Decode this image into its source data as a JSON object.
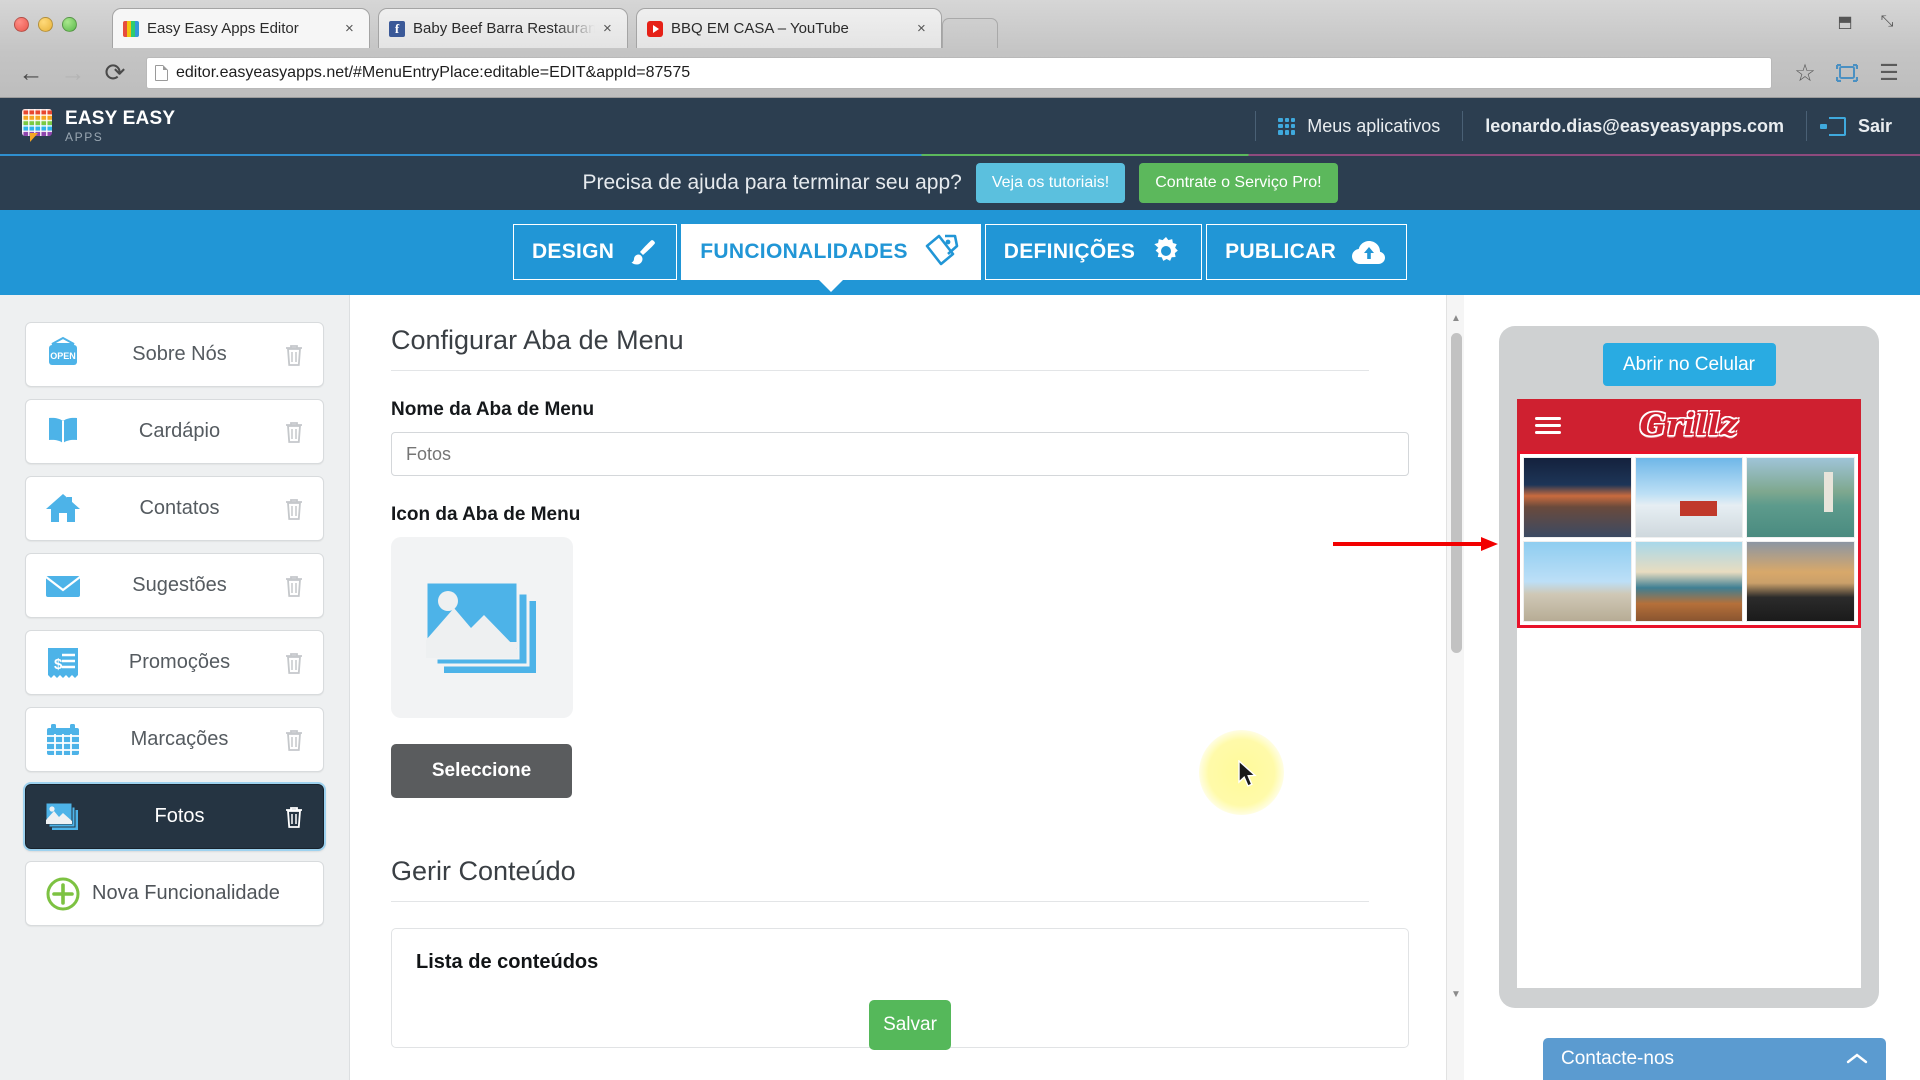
{
  "browser": {
    "tabs": [
      {
        "title": "Easy Easy Apps Editor",
        "favicon": "easyeasy-icon",
        "close": "×",
        "active": true
      },
      {
        "title": "Baby Beef Barra Restaurant",
        "favicon": "facebook-icon",
        "close": "×",
        "active": false
      },
      {
        "title": "BBQ EM CASA – YouTube",
        "favicon": "youtube-icon",
        "close": "×",
        "active": false
      }
    ],
    "facebook_glyph": "f",
    "back": "←",
    "forward": "→",
    "reload": "⟳",
    "url": "editor.easyeasyapps.net/#MenuEntryPlace:editable=EDIT&appId=87575",
    "bookmark_star": "☆",
    "cast_icon": "cast-icon",
    "menu_icon": "☰",
    "window_minimize": "⬒",
    "window_maximize": "⤡"
  },
  "header": {
    "logo_line1": "EASY EASY",
    "logo_line2": "APPS",
    "apps_label": "Meus aplicativos",
    "user_email": "leonardo.dias@easyeasyapps.com",
    "logout_label": "Sair"
  },
  "promo": {
    "text": "Precisa de ajuda para terminar seu app?",
    "tutorials_label": "Veja os tutoriais!",
    "pro_label": "Contrate o Serviço Pro!",
    "tutorials_color": "#5bc0de",
    "pro_color": "#5cb85c"
  },
  "nav_tabs": [
    {
      "label": "DESIGN",
      "icon": "brush-icon",
      "active": false
    },
    {
      "label": "FUNCIONALIDADES",
      "icon": "tags-icon",
      "active": true
    },
    {
      "label": "DEFINIÇÕES",
      "icon": "gear-icon",
      "active": false
    },
    {
      "label": "PUBLICAR",
      "icon": "cloud-upload-icon",
      "active": false
    }
  ],
  "sidebar": {
    "items": [
      {
        "label": "Sobre Nós",
        "icon": "open-sign-icon",
        "selected": false
      },
      {
        "label": "Cardápio",
        "icon": "book-icon",
        "selected": false
      },
      {
        "label": "Contatos",
        "icon": "house-icon",
        "selected": false
      },
      {
        "label": "Sugestões",
        "icon": "envelope-icon",
        "selected": false
      },
      {
        "label": "Promoções",
        "icon": "receipt-dollar-icon",
        "selected": false
      },
      {
        "label": "Marcações",
        "icon": "calendar-icon",
        "selected": false
      },
      {
        "label": "Fotos",
        "icon": "photos-icon",
        "selected": true
      }
    ],
    "new_feature_label": "Nova Funcionalidade",
    "trash_icon": "trash-icon",
    "plus_icon": "plus-circle-icon"
  },
  "main": {
    "section_title": "Configurar Aba de Menu",
    "name_label": "Nome da Aba de Menu",
    "name_value": "Fotos",
    "name_placeholder": "Fotos",
    "icon_label": "Icon da Aba de Menu",
    "icon_preview": "photos-icon",
    "select_button": "Seleccione",
    "manage_title": "Gerir Conteúdo",
    "content_list_title": "Lista de conteúdos",
    "save_button": "Salvar",
    "save_color": "#55b85a",
    "scrollbar_up": "▲",
    "scrollbar_down": "▼"
  },
  "preview": {
    "open_mobile_label": "Abrir no Celular",
    "app_name": "Grillz",
    "header_color": "#cf2030",
    "menu_icon": "hamburger-icon",
    "highlight_color": "#e8122a",
    "photos": [
      {
        "name": "snow-mountain-photo"
      },
      {
        "name": "red-barn-winter-photo"
      },
      {
        "name": "lake-church-tower-photo"
      },
      {
        "name": "monument-statue-photo"
      },
      {
        "name": "coastal-cliff-photo"
      },
      {
        "name": "sunset-rock-beach-photo"
      }
    ]
  },
  "annotations": {
    "arrow": "red-arrow-pointing-to-preview",
    "cursor": "mouse-cursor-highlight"
  },
  "chat": {
    "label": "Contacte-nos",
    "chevron": "chevron-up-icon",
    "color": "#5b9bd0"
  }
}
